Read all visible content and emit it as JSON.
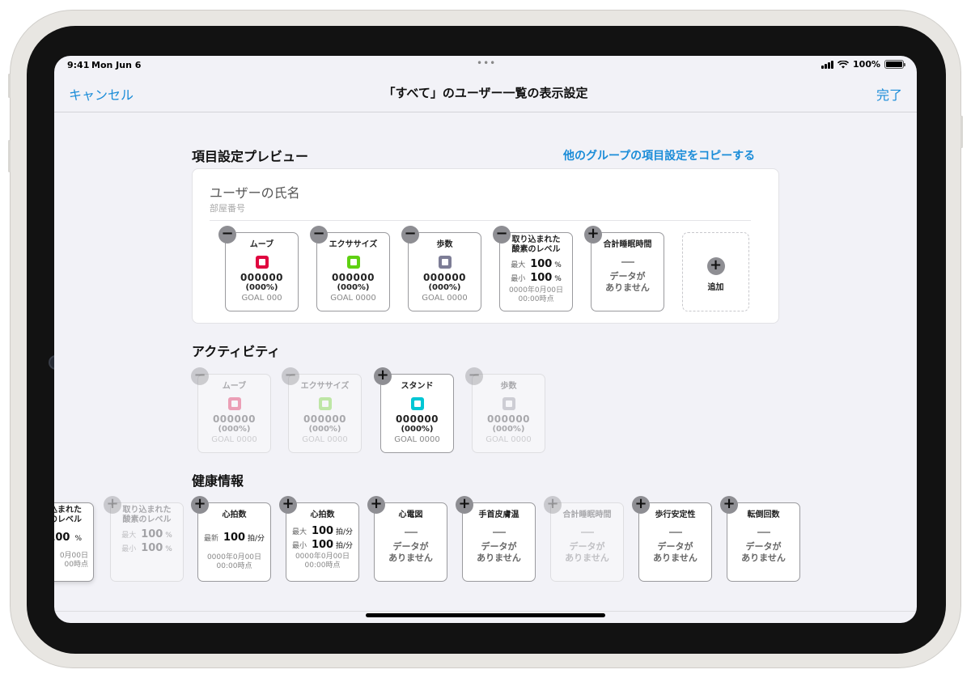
{
  "status": {
    "time": "9:41",
    "date": "Mon Jun 6",
    "battery": "100%"
  },
  "nav": {
    "cancel": "キャンセル",
    "title": "「すべて」のユーザー一覧の表示設定",
    "done": "完了"
  },
  "preview": {
    "title": "項目設定プレビュー",
    "copy_link": "他のグループの項目設定をコピーする",
    "user_name": "ユーザーの氏名",
    "room": "部屋番号",
    "add_label": "追加",
    "move": {
      "label": "ムーブ",
      "value": "000000",
      "pct": "(000%)",
      "goal": "GOAL 000",
      "color": "#e0063f"
    },
    "exercise": {
      "label": "エクササイズ",
      "value": "000000",
      "pct": "(000%)",
      "goal": "GOAL 0000",
      "color": "#5fd112"
    },
    "steps": {
      "label": "歩数",
      "value": "000000",
      "pct": "(000%)",
      "goal": "GOAL 0000",
      "color": "#7d7d96"
    },
    "oxygen": {
      "label1": "取り込まれた",
      "label2": "酸素のレベル",
      "max_label": "最大",
      "max_val": "100",
      "min_label": "最小",
      "min_val": "100",
      "unit": "%",
      "ts1": "0000年0月00日",
      "ts2": "00:00時点"
    },
    "sleep": {
      "label": "合計睡眠時間",
      "nodata1": "データが",
      "nodata2": "ありません"
    }
  },
  "activity": {
    "title": "アクティビティ",
    "move": {
      "label": "ムーブ",
      "value": "000000",
      "pct": "(000%)",
      "goal": "GOAL 0000",
      "color": "#e0063f"
    },
    "exercise": {
      "label": "エクササイズ",
      "value": "000000",
      "pct": "(000%)",
      "goal": "GOAL 0000",
      "color": "#5fd112"
    },
    "stand": {
      "label": "スタンド",
      "value": "000000",
      "pct": "(000%)",
      "goal": "GOAL 0000",
      "color": "#00c6d4"
    },
    "steps": {
      "label": "歩数",
      "value": "000000",
      "pct": "(000%)",
      "goal": "GOAL 0000",
      "color": "#8a8a96"
    }
  },
  "health": {
    "title": "健康情報",
    "oxygen_partial": {
      "label1": "込まれた",
      "label2": "のレベル",
      "val": "100",
      "unit": "%",
      "ts1": "0月00日",
      "ts2": "00時点"
    },
    "oxygen_dim": {
      "label1": "取り込まれた",
      "label2": "酸素のレベル",
      "max_label": "最大",
      "max_val": "100",
      "min_label": "最小",
      "min_val": "100",
      "unit": "%"
    },
    "hr_latest": {
      "label": "心拍数",
      "latest_label": "最新",
      "val": "100",
      "unit": "拍/分",
      "ts1": "0000年0月00日",
      "ts2": "00:00時点"
    },
    "hr_range": {
      "label": "心拍数",
      "max_label": "最大",
      "max_val": "100",
      "min_label": "最小",
      "min_val": "100",
      "unit": "拍/分",
      "ts1": "0000年0月00日",
      "ts2": "00:00時点"
    },
    "ecg": {
      "label": "心電図"
    },
    "skin_temp": {
      "label": "手首皮膚温"
    },
    "sleep": {
      "label": "合計睡眠時間"
    },
    "walk_stability": {
      "label": "歩行安定性"
    },
    "falls": {
      "label": "転倒回数"
    },
    "nodata1": "データが",
    "nodata2": "ありません"
  },
  "icons": {
    "minus": "−",
    "plus": "+"
  }
}
